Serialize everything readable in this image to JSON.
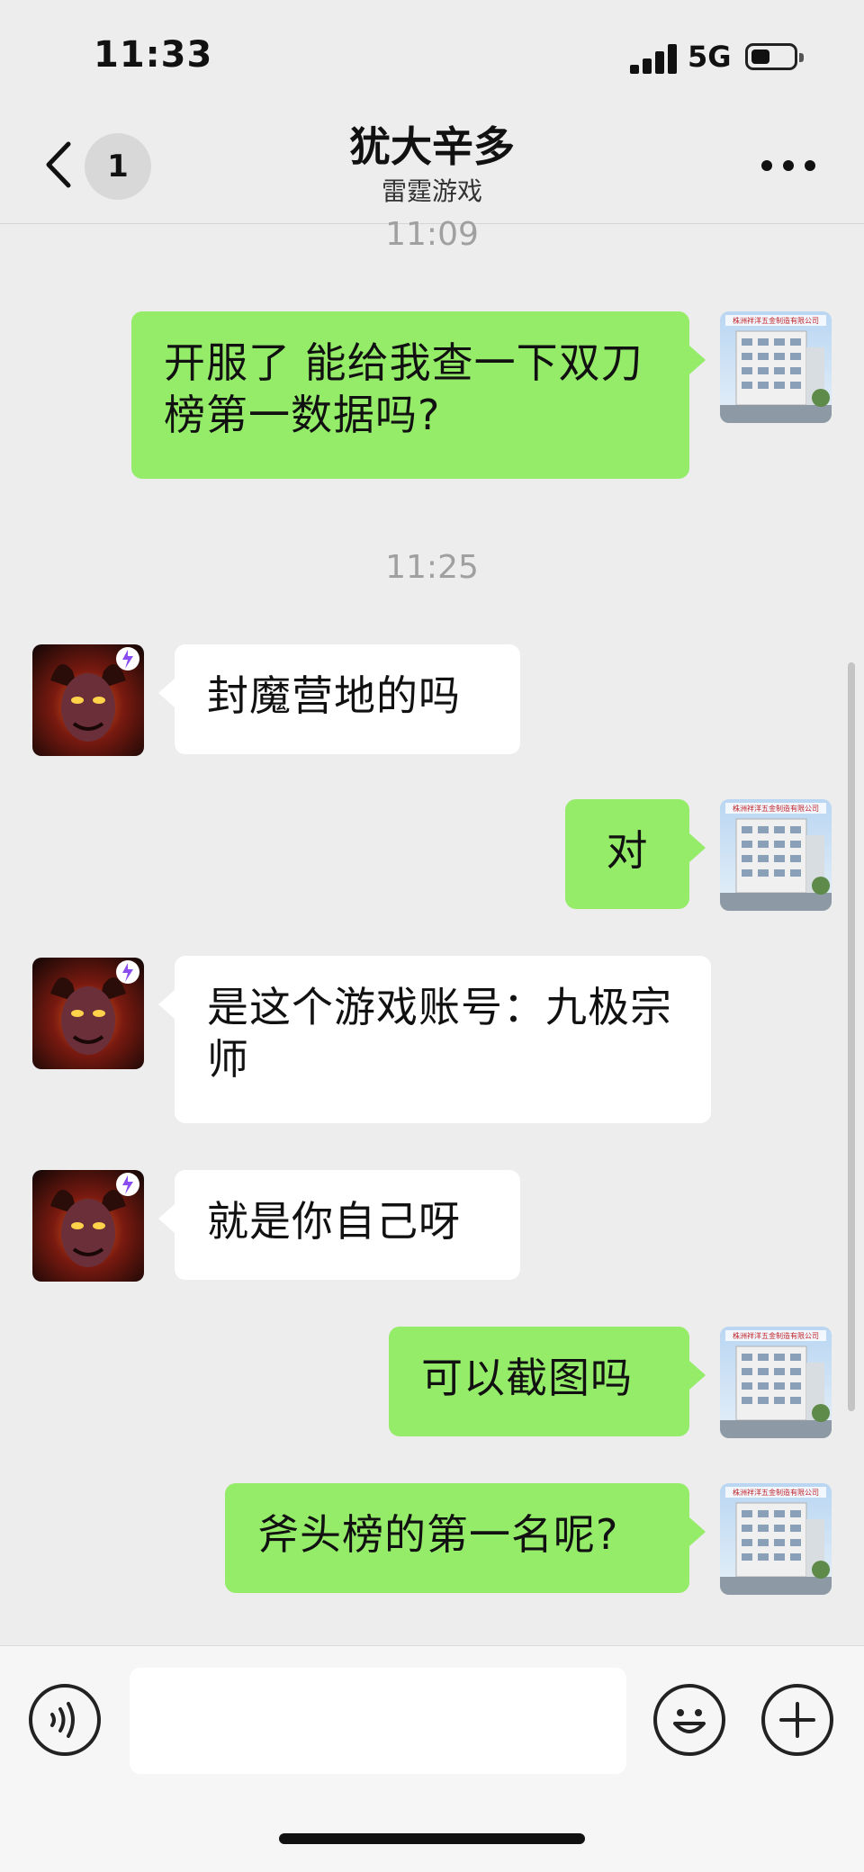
{
  "status_bar": {
    "time": "11:33",
    "network": "5G",
    "battery_level": 0.45
  },
  "header": {
    "unread_count": "1",
    "title": "犹大辛多",
    "subtitle": "雷霆游戏"
  },
  "messages": [
    {
      "type": "timestamp",
      "text": "11:09"
    },
    {
      "type": "message",
      "side": "out",
      "text": " 开服了 能给我查一下双刀榜第一数据吗?"
    },
    {
      "type": "timestamp",
      "text": "11:25"
    },
    {
      "type": "message",
      "side": "in",
      "text": "封魔营地的吗"
    },
    {
      "type": "message",
      "side": "out",
      "text": "对"
    },
    {
      "type": "message",
      "side": "in",
      "text": "是这个游戏账号：九极宗师"
    },
    {
      "type": "message",
      "side": "in",
      "text": "就是你自己呀"
    },
    {
      "type": "message",
      "side": "out",
      "text": "可以截图吗"
    },
    {
      "type": "message",
      "side": "out",
      "text": "斧头榜的第一名呢?"
    }
  ],
  "avatars": {
    "self_sign_text": "株洲祥洋五金制造有限公司",
    "contact_icon": "demon-game-avatar"
  },
  "input_bar": {
    "voice_icon": "voice-icon",
    "emoji_icon": "emoji-icon",
    "more_icon": "plus-icon",
    "text_value": ""
  },
  "colors": {
    "background": "#ededed",
    "outgoing_bubble": "#95ec69",
    "incoming_bubble": "#ffffff",
    "timestamp": "#a0a0a0"
  }
}
